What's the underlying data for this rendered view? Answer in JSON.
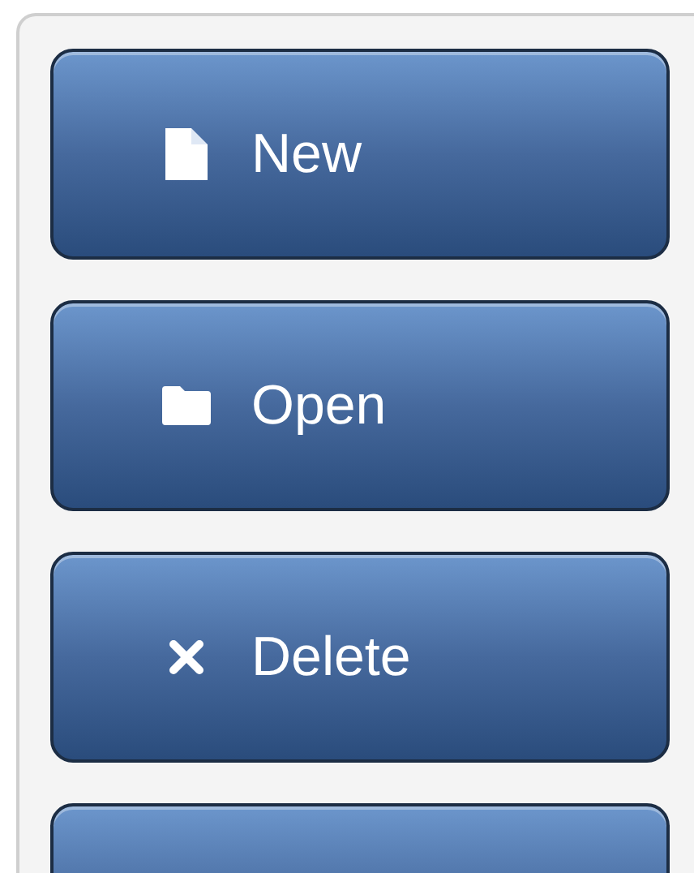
{
  "buttons": [
    {
      "kind": "file",
      "label": "New"
    },
    {
      "kind": "folder",
      "label": "Open"
    },
    {
      "kind": "remove",
      "label": "Delete"
    },
    {
      "kind": "blank"
    }
  ]
}
